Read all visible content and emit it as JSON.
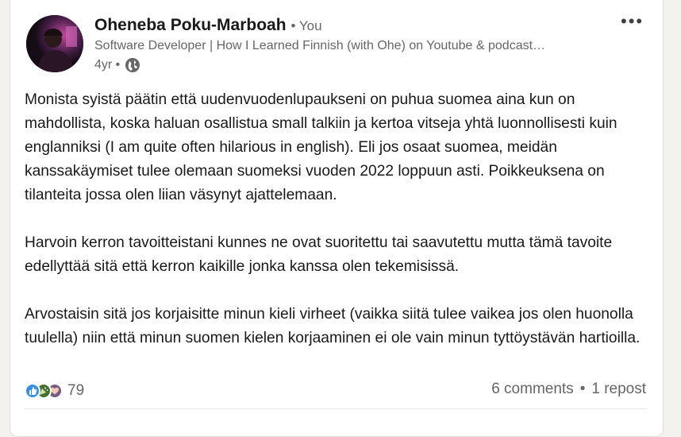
{
  "post": {
    "author": {
      "name": "Oheneba Poku-Marboah",
      "relation": "• You",
      "headline": "Software Developer | How I Learned Finnish (with Ohe) on Youtube & podcast…",
      "age": "4yr •"
    },
    "body": {
      "p1": "Monista syistä päätin että uudenvuodenlupaukseni on puhua suomea aina kun on mahdollista, koska haluan osallistua small talkiin ja kertoa vitseja yhtä luonnollisesti kuin englanniksi (I am quite often hilarious in english). Eli jos osaat suomea, meidän kanssakäymiset tulee olemaan suomeksi vuoden 2022 loppuun asti. Poikkeuksena on tilanteita jossa olen liian väsynyt ajattelemaan.",
      "p2": "Harvoin kerron tavoitteistani kunnes ne ovat suoritettu tai saavutettu mutta tämä tavoite edellyttää sitä että kerron kaikille jonka kanssa olen tekemisissä.",
      "p3": "Arvostaisin sitä jos korjaisitte minun kieli virheet (vaikka siitä tulee vaikea jos olen huonolla tuulella) niin että minun suomen kielen korjaaminen ei ole vain minun tyttöystävän hartioilla."
    },
    "social": {
      "reaction_count": "79",
      "comments": "6 comments",
      "separator": "•",
      "reposts": "1 repost"
    },
    "icons": {
      "more": "more-horizontal-icon",
      "visibility": "globe-icon",
      "reactions": [
        "like-icon",
        "celebrate-icon",
        "support-icon"
      ]
    },
    "colors": {
      "like": "#378fe9",
      "celebrate": "#44712e",
      "support": "#715e86"
    }
  }
}
